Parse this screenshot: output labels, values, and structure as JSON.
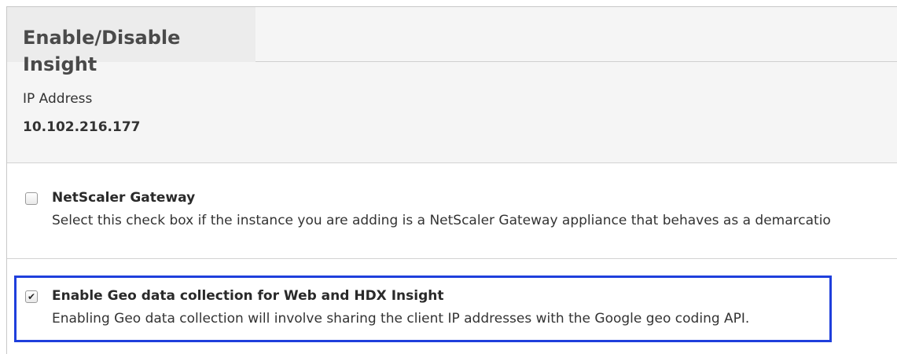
{
  "header": {
    "title": "Enable/Disable Insight",
    "ip_label": "IP Address",
    "ip_value": "10.102.216.177"
  },
  "options": [
    {
      "title": "NetScaler Gateway",
      "description": "Select this check box if the instance you are adding is a NetScaler Gateway appliance that behaves as a demarcatio",
      "checked": false
    },
    {
      "title": "Enable Geo data collection for Web and HDX Insight",
      "description": "Enabling Geo data collection will involve sharing the client IP addresses with the Google geo coding API.",
      "checked": true
    }
  ],
  "colors": {
    "highlight": "#1f3fdc",
    "header_bg": "#f5f5f5"
  }
}
